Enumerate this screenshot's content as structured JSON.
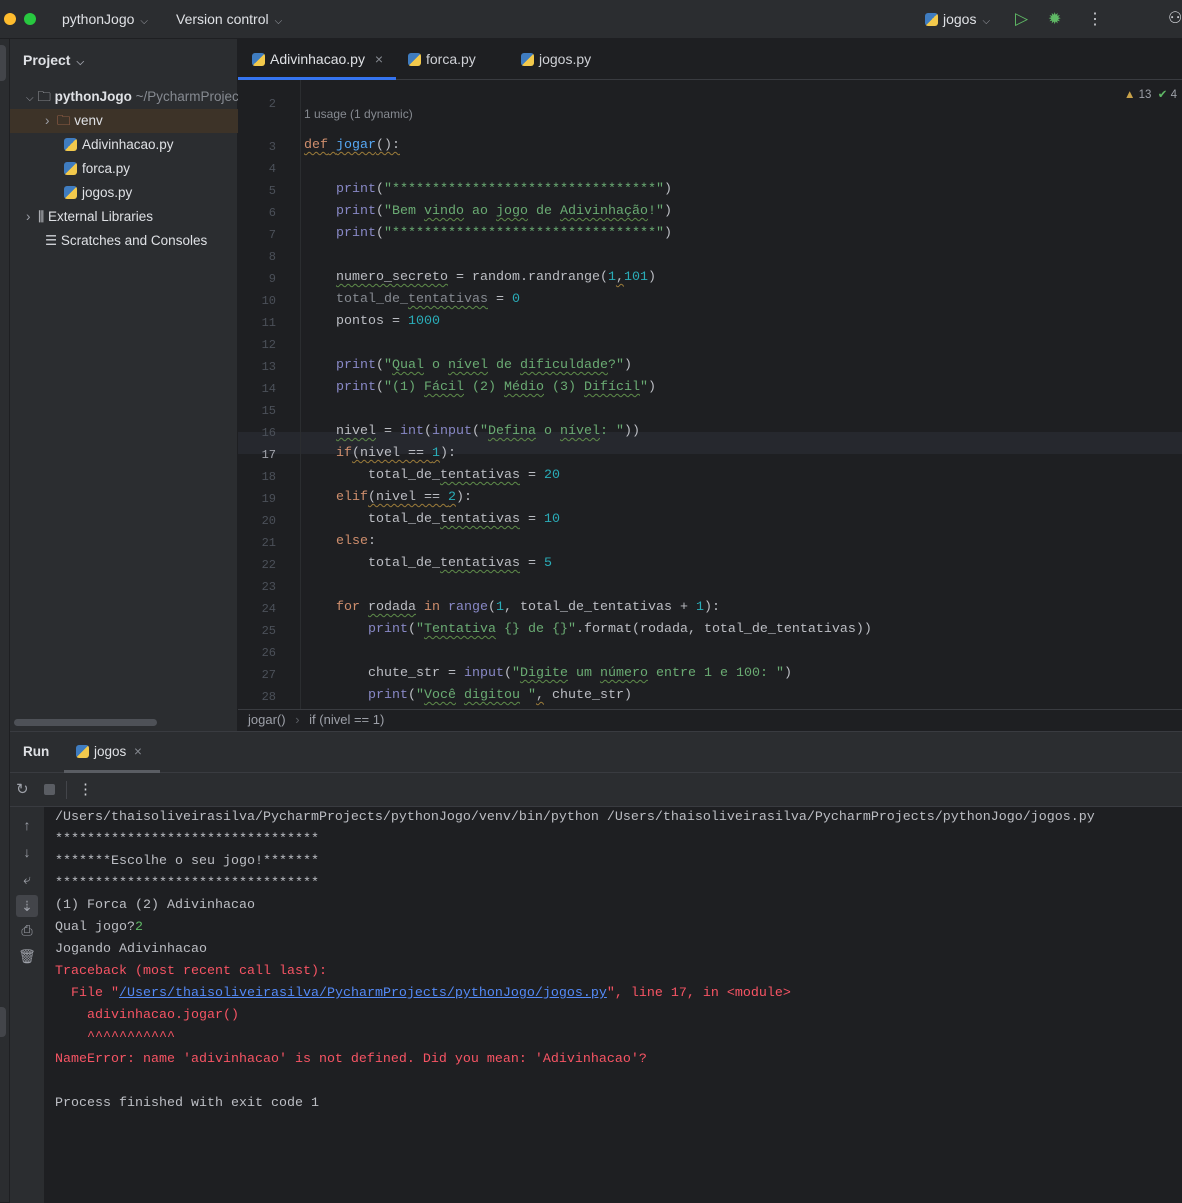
{
  "topbar": {
    "project": "pythonJogo",
    "vcs": "Version control",
    "run_config": "jogos"
  },
  "project_panel": {
    "title": "Project",
    "root": "pythonJogo",
    "root_path": "~/PycharmProjects/pythonJogo",
    "items": [
      {
        "label": "venv"
      },
      {
        "label": "Adivinhacao.py"
      },
      {
        "label": "forca.py"
      },
      {
        "label": "jogos.py"
      },
      {
        "label": "External Libraries"
      },
      {
        "label": "Scratches and Consoles"
      }
    ]
  },
  "tabs": [
    {
      "label": "Adivinhacao.py",
      "active": true
    },
    {
      "label": "forca.py"
    },
    {
      "label": "jogos.py"
    }
  ],
  "inspections": {
    "warnings": "13",
    "ok": "4"
  },
  "usage_hint": "1 usage (1 dynamic)",
  "code": [
    {
      "n": "2",
      "t": []
    },
    {
      "n": "3",
      "t": [
        [
          "def",
          "kw wy"
        ],
        [
          " ",
          "wy"
        ],
        [
          "jogar",
          "fn wy"
        ],
        [
          "():",
          "wy"
        ]
      ]
    },
    {
      "n": "4",
      "t": []
    },
    {
      "n": "5",
      "t": [
        [
          "    ",
          ""
        ],
        [
          "print",
          "bi"
        ],
        [
          "(",
          ""
        ],
        [
          "\"*********************************\"",
          "str"
        ],
        [
          ")",
          ""
        ]
      ]
    },
    {
      "n": "6",
      "t": [
        [
          "    ",
          ""
        ],
        [
          "print",
          "bi"
        ],
        [
          "(",
          ""
        ],
        [
          "\"Bem ",
          "str"
        ],
        [
          "vindo",
          "str w"
        ],
        [
          " ao ",
          "str"
        ],
        [
          "jogo",
          "str w"
        ],
        [
          " de ",
          "str"
        ],
        [
          "Adivinhação",
          "str w"
        ],
        [
          "!\"",
          "str"
        ],
        [
          ")",
          ""
        ]
      ]
    },
    {
      "n": "7",
      "t": [
        [
          "    ",
          ""
        ],
        [
          "print",
          "bi"
        ],
        [
          "(",
          ""
        ],
        [
          "\"*********************************\"",
          "str"
        ],
        [
          ")",
          ""
        ]
      ]
    },
    {
      "n": "8",
      "t": []
    },
    {
      "n": "9",
      "t": [
        [
          "    ",
          ""
        ],
        [
          "numero_secreto",
          "w"
        ],
        [
          " = random.randrange(",
          ""
        ],
        [
          "1",
          "num"
        ],
        [
          ",",
          "wy"
        ],
        [
          "101",
          "num"
        ],
        [
          ")",
          ""
        ]
      ]
    },
    {
      "n": "10",
      "t": [
        [
          "    ",
          ""
        ],
        [
          "total_de_",
          "gray"
        ],
        [
          "tentativas",
          "gray w"
        ],
        [
          " = ",
          ""
        ],
        [
          "0",
          "num"
        ]
      ]
    },
    {
      "n": "11",
      "t": [
        [
          "    pontos = ",
          ""
        ],
        [
          "1000",
          "num"
        ]
      ]
    },
    {
      "n": "12",
      "t": []
    },
    {
      "n": "13",
      "t": [
        [
          "    ",
          ""
        ],
        [
          "print",
          "bi"
        ],
        [
          "(",
          ""
        ],
        [
          "\"",
          "str"
        ],
        [
          "Qual",
          "str w"
        ],
        [
          " o ",
          "str"
        ],
        [
          "nível",
          "str w"
        ],
        [
          " de ",
          "str"
        ],
        [
          "dificuldade",
          "str w"
        ],
        [
          "?\"",
          "str"
        ],
        [
          ")",
          ""
        ]
      ]
    },
    {
      "n": "14",
      "t": [
        [
          "    ",
          ""
        ],
        [
          "print",
          "bi"
        ],
        [
          "(",
          ""
        ],
        [
          "\"(1) ",
          "str"
        ],
        [
          "Fácil",
          "str w"
        ],
        [
          " (2) ",
          "str"
        ],
        [
          "Médio",
          "str w"
        ],
        [
          " (3) ",
          "str"
        ],
        [
          "Difícil",
          "str w"
        ],
        [
          "\"",
          "str"
        ],
        [
          ")",
          ""
        ]
      ]
    },
    {
      "n": "15",
      "t": []
    },
    {
      "n": "16",
      "t": [
        [
          "    ",
          ""
        ],
        [
          "nivel",
          "w"
        ],
        [
          " = ",
          ""
        ],
        [
          "int",
          "bi"
        ],
        [
          "(",
          ""
        ],
        [
          "input",
          "bi"
        ],
        [
          "(",
          ""
        ],
        [
          "\"",
          "str"
        ],
        [
          "Defina",
          "str w"
        ],
        [
          " o ",
          "str"
        ],
        [
          "nível",
          "str w"
        ],
        [
          ": \"",
          "str"
        ],
        [
          "))",
          ""
        ]
      ]
    },
    {
      "n": "17",
      "t": [
        [
          "    ",
          ""
        ],
        [
          "if",
          "kw"
        ],
        [
          "(nivel == ",
          "wy"
        ],
        [
          "1",
          "num wy"
        ],
        [
          "):",
          ""
        ]
      ]
    },
    {
      "n": "18",
      "t": [
        [
          "        total_de_",
          ""
        ],
        [
          "tentativas",
          "w"
        ],
        [
          " = ",
          ""
        ],
        [
          "20",
          "num"
        ]
      ]
    },
    {
      "n": "19",
      "t": [
        [
          "    ",
          ""
        ],
        [
          "elif",
          "kw"
        ],
        [
          "(nivel == ",
          "wy"
        ],
        [
          "2",
          "num wy"
        ],
        [
          "):",
          ""
        ]
      ]
    },
    {
      "n": "20",
      "t": [
        [
          "        total_de_",
          ""
        ],
        [
          "tentativas",
          "w"
        ],
        [
          " = ",
          ""
        ],
        [
          "10",
          "num"
        ]
      ]
    },
    {
      "n": "21",
      "t": [
        [
          "    ",
          ""
        ],
        [
          "else",
          "kw"
        ],
        [
          ":",
          ""
        ]
      ]
    },
    {
      "n": "22",
      "t": [
        [
          "        total_de_",
          ""
        ],
        [
          "tentativas",
          "w"
        ],
        [
          " = ",
          ""
        ],
        [
          "5",
          "num"
        ]
      ]
    },
    {
      "n": "23",
      "t": []
    },
    {
      "n": "24",
      "t": [
        [
          "    ",
          ""
        ],
        [
          "for",
          "kw"
        ],
        [
          " ",
          ""
        ],
        [
          "rodada",
          "w"
        ],
        [
          " ",
          ""
        ],
        [
          "in",
          "kw"
        ],
        [
          " ",
          ""
        ],
        [
          "range",
          "bi"
        ],
        [
          "(",
          ""
        ],
        [
          "1",
          "num"
        ],
        [
          ", total_de_tentativas + ",
          ""
        ],
        [
          "1",
          "num"
        ],
        [
          "):",
          ""
        ]
      ]
    },
    {
      "n": "25",
      "t": [
        [
          "        ",
          ""
        ],
        [
          "print",
          "bi"
        ],
        [
          "(",
          ""
        ],
        [
          "\"",
          "str"
        ],
        [
          "Tentativa",
          "str w"
        ],
        [
          " {} de {}\"",
          "str"
        ],
        [
          ".format(rodada, total_de_tentativas))",
          ""
        ]
      ]
    },
    {
      "n": "26",
      "t": []
    },
    {
      "n": "27",
      "t": [
        [
          "        chute_str = ",
          ""
        ],
        [
          "input",
          "bi"
        ],
        [
          "(",
          ""
        ],
        [
          "\"",
          "str"
        ],
        [
          "Digite",
          "str w"
        ],
        [
          " um ",
          "str"
        ],
        [
          "número",
          "str w"
        ],
        [
          " entre 1 e 100: \"",
          "str"
        ],
        [
          ")",
          ""
        ]
      ]
    },
    {
      "n": "28",
      "t": [
        [
          "        ",
          ""
        ],
        [
          "print",
          "bi"
        ],
        [
          "(",
          ""
        ],
        [
          "\"",
          "str"
        ],
        [
          "Você",
          "str w"
        ],
        [
          " ",
          "str"
        ],
        [
          "digitou",
          "str w"
        ],
        [
          " \"",
          "str"
        ],
        [
          ",",
          "wy"
        ],
        [
          " chute_str)",
          ""
        ]
      ]
    }
  ],
  "breadcrumb": [
    "jogar()",
    "if (nivel == 1)"
  ],
  "run": {
    "title": "Run",
    "tab": "jogos",
    "console": [
      [
        [
          "/Users/thaisoliveirasilva/PycharmProjects/pythonJogo/venv/bin/python /Users/thaisoliveirasilva/PycharmProjects/pythonJogo/jogos.py",
          ""
        ]
      ],
      [
        [
          "*********************************",
          ""
        ]
      ],
      [
        [
          "*******Escolhe o seu jogo!*******",
          ""
        ]
      ],
      [
        [
          "*********************************",
          ""
        ]
      ],
      [
        [
          "(1) Forca (2) Adivinhacao",
          ""
        ]
      ],
      [
        [
          "Qual jogo?",
          ""
        ],
        [
          "2",
          "ginp"
        ]
      ],
      [
        [
          "Jogando Adivinhacao",
          ""
        ]
      ],
      [
        [
          "Traceback (most recent call last):",
          "red"
        ]
      ],
      [
        [
          "  File \"",
          "red"
        ],
        [
          "/Users/thaisoliveirasilva/PycharmProjects/pythonJogo/jogos.py",
          "link"
        ],
        [
          "\", line 17, in <module>",
          "red"
        ]
      ],
      [
        [
          "    adivinhacao.jogar()",
          "red"
        ]
      ],
      [
        [
          "    ^^^^^^^^^^^",
          "red"
        ]
      ],
      [
        [
          "NameError: name 'adivinhacao' is not defined. Did you mean: 'Adivinhacao'?",
          "red"
        ]
      ],
      [
        [
          "",
          ""
        ]
      ],
      [
        [
          "Process finished with exit code 1",
          ""
        ]
      ]
    ]
  },
  "colors": {
    "accent": "#3574f0",
    "run_green": "#5fb865",
    "error_red": "#f75464"
  }
}
